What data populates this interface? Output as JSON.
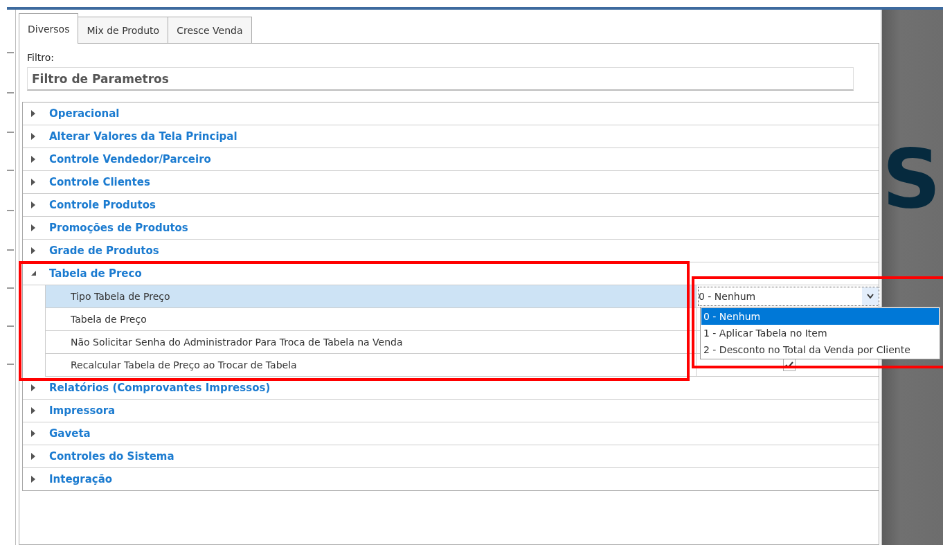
{
  "tabs": [
    {
      "label": "Diversos",
      "selected": true
    },
    {
      "label": "Mix de Produto",
      "selected": false
    },
    {
      "label": "Cresce Venda",
      "selected": false
    }
  ],
  "filter": {
    "label": "Filtro:",
    "placeholder": "Filtro de Parametros"
  },
  "groups": [
    {
      "label": "Operacional",
      "expanded": false
    },
    {
      "label": "Alterar Valores da Tela Principal",
      "expanded": false
    },
    {
      "label": "Controle Vendedor/Parceiro",
      "expanded": false
    },
    {
      "label": "Controle Clientes",
      "expanded": false
    },
    {
      "label": "Controle Produtos",
      "expanded": false
    },
    {
      "label": "Promoções de Produtos",
      "expanded": false
    },
    {
      "label": "Grade de Produtos",
      "expanded": false
    },
    {
      "label": "Tabela de Preco",
      "expanded": true,
      "highlighted": true,
      "children": [
        {
          "label": "Tipo Tabela de Preço",
          "selected": true,
          "kind": "combo",
          "value": "0 - Nenhum",
          "open": true,
          "highlighted": true,
          "options": [
            {
              "label": "0 - Nenhum",
              "selected": true
            },
            {
              "label": "1 - Aplicar Tabela no Item",
              "selected": false
            },
            {
              "label": "2 - Desconto no Total da Venda por Cliente",
              "selected": false
            }
          ]
        },
        {
          "label": "Tabela de Preço",
          "selected": false,
          "kind": "text"
        },
        {
          "label": "Não Solicitar Senha do Administrador Para Troca de Tabela na Venda",
          "selected": false,
          "kind": "text"
        },
        {
          "label": "Recalcular Tabela de Preço ao Trocar de Tabela",
          "selected": false,
          "kind": "checkbox",
          "checked": true
        }
      ]
    },
    {
      "label": "Relatórios (Comprovantes Impressos)",
      "expanded": false
    },
    {
      "label": "Impressora",
      "expanded": false
    },
    {
      "label": "Gaveta",
      "expanded": false
    },
    {
      "label": "Controles do Sistema",
      "expanded": false
    },
    {
      "label": "Integração",
      "expanded": false
    }
  ],
  "background": {
    "logo": "S"
  }
}
